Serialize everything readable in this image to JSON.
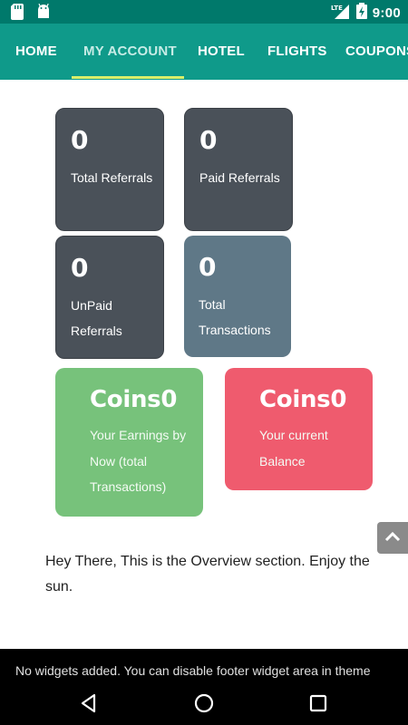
{
  "status_bar": {
    "time": "9:00",
    "network": "LTE",
    "icons": [
      "sd-card-icon",
      "android-icon",
      "signal-icon",
      "battery-charging-icon"
    ]
  },
  "tabs": [
    {
      "label": "HOME",
      "active": false
    },
    {
      "label": "MY ACCOUNT",
      "active": true
    },
    {
      "label": "HOTEL",
      "active": false
    },
    {
      "label": "FLIGHTS",
      "active": false
    },
    {
      "label": "COUPONS",
      "active": false
    }
  ],
  "stats": [
    {
      "value": "0",
      "label": "Total Referrals"
    },
    {
      "value": "0",
      "label": "Paid Referrals"
    },
    {
      "value": "0",
      "label": "UnPaid Referrals"
    },
    {
      "value": "0",
      "label": "Total Transactions"
    }
  ],
  "coins": [
    {
      "value": "Coins0",
      "label": "Your Earnings by Now (total Transactions)"
    },
    {
      "value": "Coins0",
      "label": "Your current Balance"
    }
  ],
  "overview_text": "Hey There, This is the Overview section.   Enjoy the sun.",
  "footer_text": "No widgets added. You can disable footer widget area in theme",
  "colors": {
    "status_bar": "#00796b",
    "tab_bar": "#0f9a8a",
    "tab_indicator": "#d9ef6a",
    "card_dark": "#4a5159",
    "card_slate": "#5f7887",
    "card_green": "#77c27b",
    "card_red": "#ef5b6e"
  }
}
